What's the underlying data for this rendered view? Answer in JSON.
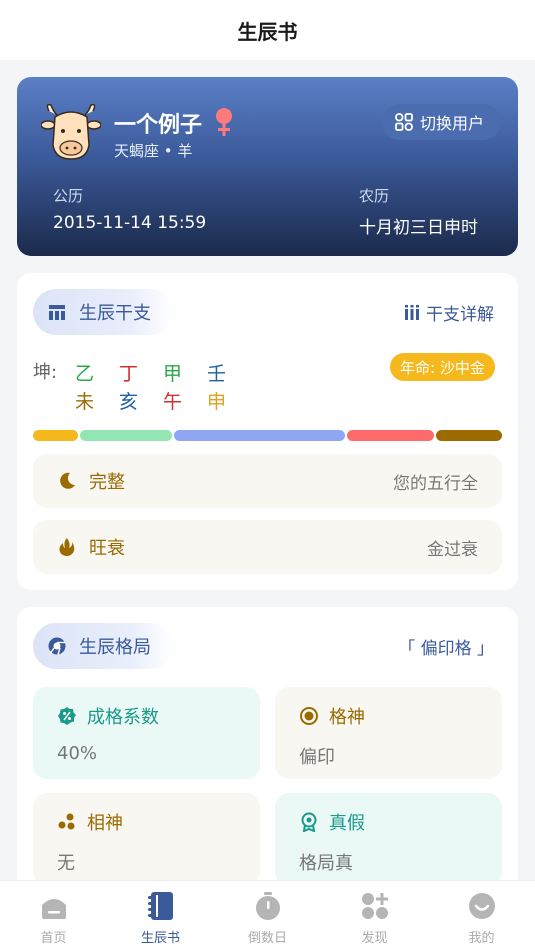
{
  "header": {
    "title": "生辰书"
  },
  "profile": {
    "name": "一个例子",
    "subtitle": "天蝎座 • 羊",
    "switch_label": "切换用户",
    "gongli_label": "公历",
    "gongli_value": "2015-11-14 15:59",
    "nongli_label": "农历",
    "nongli_value": "十月初三日申时"
  },
  "ganzhi": {
    "section_title": "生辰干支",
    "detail_link": "干支详解",
    "prefix": "坤:",
    "stems": [
      "乙",
      "丁",
      "甲",
      "壬"
    ],
    "branches": [
      "未",
      "亥",
      "午",
      "申"
    ],
    "nianming": "年命: 沙中金",
    "wuxing_bar": [
      {
        "color": "#f5b81d",
        "fraction": 0.1
      },
      {
        "color": "#93e6b3",
        "fraction": 0.2
      },
      {
        "color": "#8fa6f2",
        "fraction": 0.37
      },
      {
        "color": "#ff6b6b",
        "fraction": 0.19
      },
      {
        "color": "#9c6a00",
        "fraction": 0.14
      }
    ],
    "rows": [
      {
        "label": "完整",
        "value": "您的五行全",
        "icon": "moon-icon"
      },
      {
        "label": "旺衰",
        "value": "金过衰",
        "icon": "flame-icon"
      }
    ]
  },
  "geju": {
    "section_title": "生辰格局",
    "result_link": "「 偏印格 」",
    "tiles": [
      {
        "label": "成格系数",
        "value": "40%",
        "icon": "percent-badge-icon"
      },
      {
        "label": "格神",
        "value": "偏印",
        "icon": "target-icon"
      },
      {
        "label": "相神",
        "value": "无",
        "icon": "dots-icon"
      },
      {
        "label": "真假",
        "value": "格局真",
        "icon": "award-icon"
      }
    ]
  },
  "bottom_nav": {
    "items": [
      {
        "label": "首页",
        "icon": "home-icon",
        "active": false
      },
      {
        "label": "生辰书",
        "icon": "book-icon",
        "active": true
      },
      {
        "label": "倒数日",
        "icon": "stopwatch-icon",
        "active": false
      },
      {
        "label": "发现",
        "icon": "discover-icon",
        "active": false
      },
      {
        "label": "我的",
        "icon": "smile-icon",
        "active": false
      }
    ]
  },
  "colors": {
    "accent": "#3b5a9a",
    "stem_colors": [
      "#2ca84a",
      "#d32f2f",
      "#2ca84a",
      "#1e5fa8"
    ],
    "branch_colors": [
      "#9a6b00",
      "#1e5fa8",
      "#d32f2f",
      "#e0a020"
    ],
    "gender_icon": "#ff7b7b"
  }
}
